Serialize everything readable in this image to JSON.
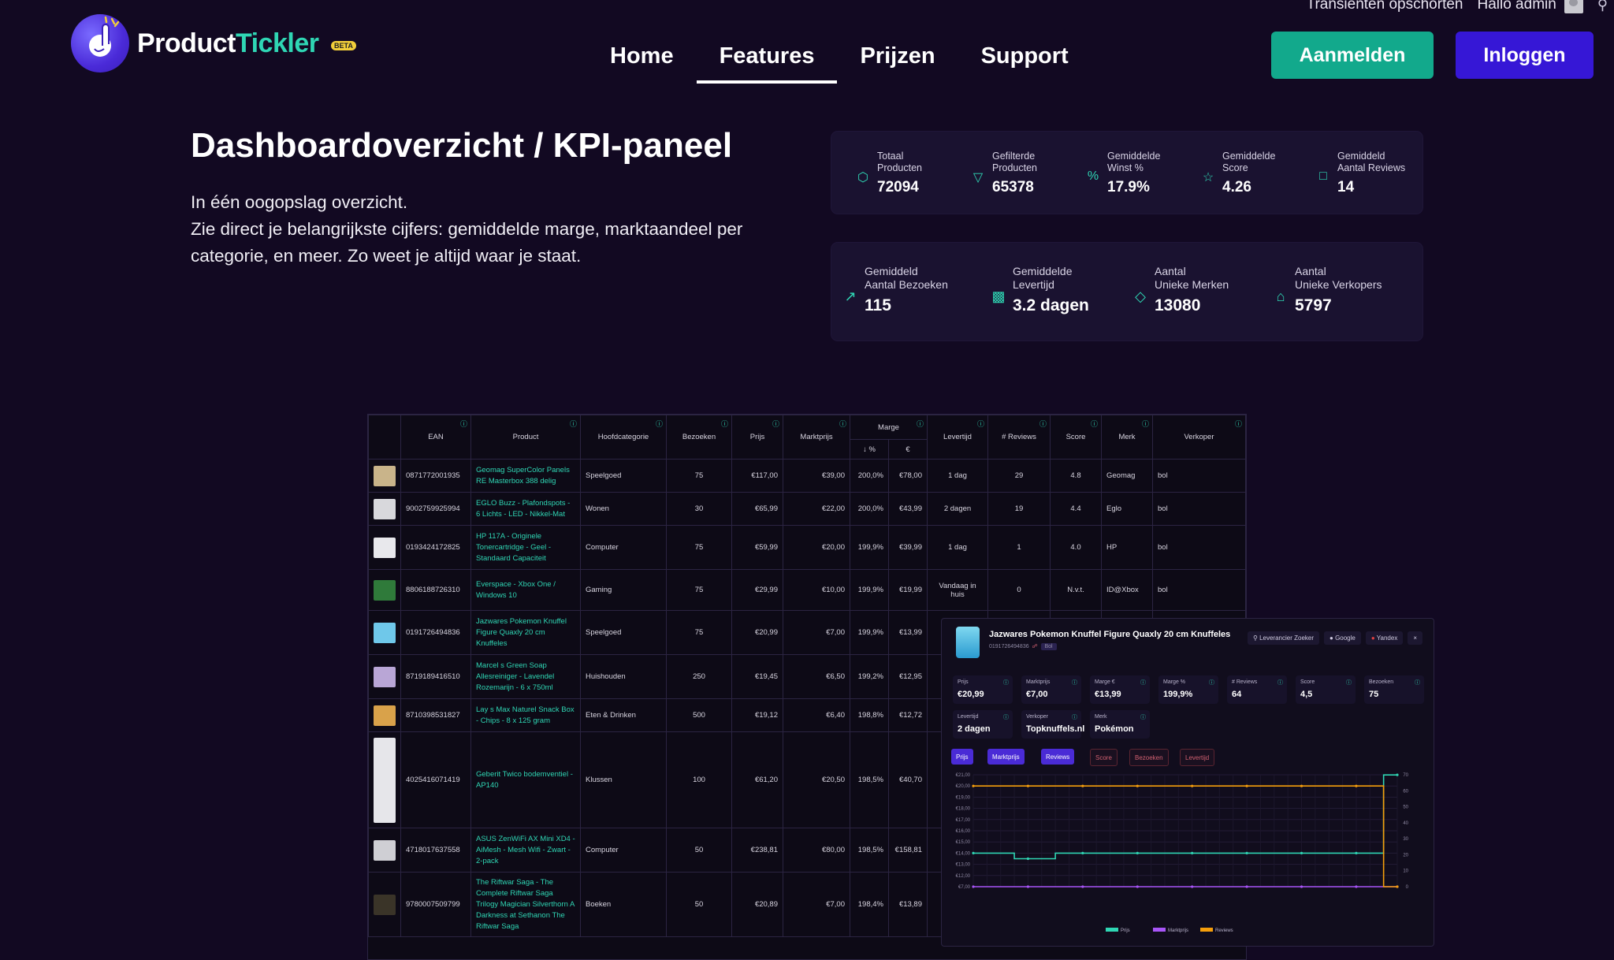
{
  "topbar": {
    "transients": "Transienten opschorten",
    "greeting": "Hallo admin"
  },
  "brand": {
    "name_part1": "Product",
    "name_part2": "Tickler",
    "badge": "BETA"
  },
  "nav": {
    "items": [
      "Home",
      "Features",
      "Prijzen",
      "Support"
    ],
    "active": "Features"
  },
  "buttons": {
    "register": "Aanmelden",
    "login": "Inloggen"
  },
  "hero": {
    "title": "Dashboardoverzicht / KPI-paneel",
    "line1": "In één oogopslag overzicht.",
    "line2": "Zie direct je belangrijkste cijfers: gemiddelde marge, marktaandeel per categorie, en meer. Zo weet je altijd waar je staat."
  },
  "kpis_row1": [
    {
      "label1": "Totaal",
      "label2": "Producten",
      "value": "72094",
      "icon": "box-icon"
    },
    {
      "label1": "Gefilterde",
      "label2": "Producten",
      "value": "65378",
      "icon": "filter-icon"
    },
    {
      "label1": "Gemiddelde",
      "label2": "Winst %",
      "value": "17.9%",
      "icon": "percent-icon"
    },
    {
      "label1": "Gemiddelde",
      "label2": "Score",
      "value": "4.26",
      "icon": "star-icon"
    },
    {
      "label1": "Gemiddeld",
      "label2": "Aantal Reviews",
      "value": "14",
      "icon": "comment-icon"
    }
  ],
  "kpis_row2": [
    {
      "label1": "Gemiddeld",
      "label2": "Aantal Bezoeken",
      "value": "115",
      "icon": "trending-icon"
    },
    {
      "label1": "Gemiddelde",
      "label2": "Levertijd",
      "value": "3.2 dagen",
      "icon": "truck-icon"
    },
    {
      "label1": "Aantal",
      "label2": "Unieke Merken",
      "value": "13080",
      "icon": "tag-icon"
    },
    {
      "label1": "Aantal",
      "label2": "Unieke Verkopers",
      "value": "5797",
      "icon": "store-icon"
    }
  ],
  "table": {
    "headers": [
      "EAN",
      "Product",
      "Hoofdcategorie",
      "Bezoeken",
      "Prijs",
      "Marktprijs",
      "Marge",
      "Levertijd",
      "# Reviews",
      "Score",
      "Merk",
      "Verkoper"
    ],
    "marge_sub": [
      "↓ %",
      "€"
    ],
    "rows": [
      {
        "ean": "0871772001935",
        "product": "Geomag SuperColor Panels RE Masterbox 388 delig",
        "cat": "Speelgoed",
        "visits": "75",
        "price": "€117,00",
        "market": "€39,00",
        "mpct": "200,0%",
        "meur": "€78,00",
        "lead": "1 dag",
        "reviews": "29",
        "score": "4.8",
        "brand": "Geomag",
        "seller": "bol",
        "thumb": "#c9b48a"
      },
      {
        "ean": "9002759925994",
        "product": "EGLO Buzz - Plafondspots - 6 Lichts - LED - Nikkel-Mat",
        "cat": "Wonen",
        "visits": "30",
        "price": "€65,99",
        "market": "€22,00",
        "mpct": "200,0%",
        "meur": "€43,99",
        "lead": "2 dagen",
        "reviews": "19",
        "score": "4.4",
        "brand": "Eglo",
        "seller": "bol",
        "thumb": "#d8d8dc"
      },
      {
        "ean": "0193424172825",
        "product": "HP 117A - Originele Tonercartridge - Geel - Standaard Capaciteit",
        "cat": "Computer",
        "visits": "75",
        "price": "€59,99",
        "market": "€20,00",
        "mpct": "199,9%",
        "meur": "€39,99",
        "lead": "1 dag",
        "reviews": "1",
        "score": "4.0",
        "brand": "HP",
        "seller": "bol",
        "thumb": "#e8e8ec"
      },
      {
        "ean": "8806188726310",
        "product": "Everspace - Xbox One / Windows 10",
        "cat": "Gaming",
        "visits": "75",
        "price": "€29,99",
        "market": "€10,00",
        "mpct": "199,9%",
        "meur": "€19,99",
        "lead": "Vandaag in huis",
        "reviews": "0",
        "score": "N.v.t.",
        "brand": "ID@Xbox",
        "seller": "bol",
        "thumb": "#2f7a3a"
      },
      {
        "ean": "0191726494836",
        "product": "Jazwares Pokemon Knuffel Figure Quaxly 20 cm Knuffeles",
        "cat": "Speelgoed",
        "visits": "75",
        "price": "€20,99",
        "market": "€7,00",
        "mpct": "199,9%",
        "meur": "€13,99",
        "lead": "",
        "reviews": "",
        "score": "",
        "brand": "",
        "seller": "",
        "thumb": "#6fc8ea"
      },
      {
        "ean": "8719189416510",
        "product": "Marcel s Green Soap Allesreiniger - Lavendel Rozemarijn - 6 x 750ml",
        "cat": "Huishouden",
        "visits": "250",
        "price": "€19,45",
        "market": "€6,50",
        "mpct": "199,2%",
        "meur": "€12,95",
        "lead": "",
        "reviews": "",
        "score": "",
        "brand": "",
        "seller": "",
        "thumb": "#b9a6d6"
      },
      {
        "ean": "8710398531827",
        "product": "Lay s Max Naturel Snack Box - Chips - 8 x 125 gram",
        "cat": "Eten & Drinken",
        "visits": "500",
        "price": "€19,12",
        "market": "€6,40",
        "mpct": "198,8%",
        "meur": "€12,72",
        "lead": "",
        "reviews": "",
        "score": "",
        "brand": "",
        "seller": "",
        "thumb": "#d9a24a"
      },
      {
        "ean": "4025416071419",
        "product": "Geberit Twico bodemventiel - AP140",
        "cat": "Klussen",
        "visits": "100",
        "price": "€61,20",
        "market": "€20,50",
        "mpct": "198,5%",
        "meur": "€40,70",
        "lead": "",
        "reviews": "",
        "score": "",
        "brand": "",
        "seller": "",
        "thumb": "#e6e6ea"
      },
      {
        "ean": "4718017637558",
        "product": "ASUS ZenWiFi AX Mini XD4 - AiMesh - Mesh Wifi - Zwart - 2-pack",
        "cat": "Computer",
        "visits": "50",
        "price": "€238,81",
        "market": "€80,00",
        "mpct": "198,5%",
        "meur": "€158,81",
        "lead": "",
        "reviews": "",
        "score": "",
        "brand": "",
        "seller": "",
        "thumb": "#cfcfd4"
      },
      {
        "ean": "9780007509799",
        "product": "The Riftwar Saga - The Complete Riftwar Saga Trilogy Magician Silverthorn A Darkness at Sethanon The Riftwar Saga",
        "cat": "Boeken",
        "visits": "50",
        "price": "€20,89",
        "market": "€7,00",
        "mpct": "198,4%",
        "meur": "€13,89",
        "lead": "",
        "reviews": "",
        "score": "",
        "brand": "",
        "seller": "",
        "thumb": "#3a3428"
      }
    ]
  },
  "detail": {
    "title": "Jazwares Pokemon Knuffel Figure Quaxly 20 cm Knuffeles",
    "ean": "0191726494836",
    "chip": "Bol",
    "tools": [
      "Leverancier Zoeker",
      "Google",
      "Yandex",
      "×"
    ],
    "stats": [
      {
        "label": "Prijs",
        "value": "€20,99"
      },
      {
        "label": "Marktprijs",
        "value": "€7,00"
      },
      {
        "label": "Marge €",
        "value": "€13,99"
      },
      {
        "label": "Marge %",
        "value": "199,9%"
      },
      {
        "label": "# Reviews",
        "value": "64"
      },
      {
        "label": "Score",
        "value": "4,5"
      },
      {
        "label": "Bezoeken",
        "value": "75"
      },
      {
        "label": "Levertijd",
        "value": "2 dagen"
      },
      {
        "label": "Verkoper",
        "value": "Topknuffels.nl"
      },
      {
        "label": "Merk",
        "value": "Pokémon"
      }
    ],
    "toggles_on": [
      "Prijs",
      "Marktprijs",
      "Reviews"
    ],
    "toggles_off": [
      "Score",
      "Bezoeken",
      "Levertijd"
    ],
    "legend": [
      "Prijs",
      "Marktprijs",
      "Reviews"
    ]
  },
  "chart_data": {
    "type": "line",
    "y_left_ticks": [
      "€7,00",
      "€12,00",
      "€13,00",
      "€14,00",
      "€15,00",
      "€16,00",
      "€17,00",
      "€18,00",
      "€19,00",
      "€20,00",
      "€21,00"
    ],
    "y_right_ticks": [
      "0",
      "10",
      "20",
      "30",
      "40",
      "50",
      "60",
      "70"
    ],
    "series": [
      {
        "name": "Prijs",
        "color": "#2fd6b4",
        "values": [
          14.0,
          14.0,
          14.0,
          13.5,
          13.5,
          13.5,
          14.0,
          14.0,
          14.0,
          14.0,
          14.0,
          14.0,
          14.0,
          14.0,
          14.0,
          14.0,
          14.0,
          14.0,
          14.0,
          14.0,
          14.0,
          14.0,
          14.0,
          14.0,
          14.0,
          14.0,
          14.0,
          14.0,
          14.0,
          14.0,
          20.99,
          20.99
        ]
      },
      {
        "name": "Marktprijs",
        "color": "#a855f7",
        "values": [
          7.0,
          7.0,
          7.0,
          7.0,
          7.0,
          7.0,
          7.0,
          7.0,
          7.0,
          7.0,
          7.0,
          7.0,
          7.0,
          7.0,
          7.0,
          7.0,
          7.0,
          7.0,
          7.0,
          7.0,
          7.0,
          7.0,
          7.0,
          7.0,
          7.0,
          7.0,
          7.0,
          7.0,
          7.0,
          7.0,
          7.0,
          7.0
        ]
      },
      {
        "name": "Reviews",
        "color": "#f59e0b",
        "values": [
          63,
          63,
          63,
          63,
          63,
          63,
          63,
          63,
          63,
          63,
          63,
          63,
          63,
          63,
          63,
          63,
          63,
          63,
          63,
          63,
          63,
          63,
          63,
          63,
          63,
          63,
          63,
          63,
          63,
          63,
          0,
          0
        ]
      }
    ]
  }
}
